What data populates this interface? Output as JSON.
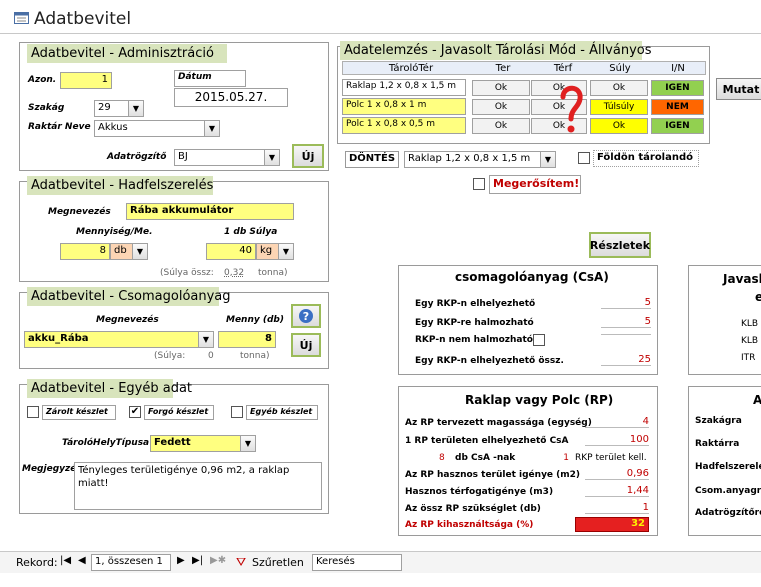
{
  "window": {
    "title": "Adatbevitel"
  },
  "admin": {
    "title": "Adatbevitel - Adminisztráció",
    "azon_label": "Azon.",
    "azon_value": "1",
    "datum_label": "Dátum",
    "datum_value": "2015.05.27.",
    "szakag_label": "Szakág",
    "szakag_value": "29",
    "raktar_label": "Raktár Neve",
    "raktar_value": "Akkus",
    "rogzito_label": "Adatrögzítő",
    "rogzito_value": "BJ",
    "uj_label": "Új"
  },
  "hadf": {
    "title": "Adatbevitel - Hadfelszerelés",
    "megnev_label": "Megnevezés",
    "megnev_value": "Rába akkumulátor",
    "menny_label": "Mennyiség/Me.",
    "menny_value": "8",
    "me_value": "db",
    "suly_label": "1 db Súlya",
    "suly_value": "40",
    "suly_unit": "kg",
    "ossz_label": "(Súlya össz:",
    "ossz_value": "0,32",
    "ossz_unit": "tonna)"
  },
  "csom": {
    "title": "Adatbevitel - Csomagolóanyag",
    "megnev_label": "Megnevezés",
    "megnev_value": "akku_Rába",
    "menny_label": "Menny (db)",
    "menny_value": "8",
    "suly_label": "(Súlya:",
    "suly_value": "0",
    "suly_unit": "tonna)",
    "uj_label": "Új"
  },
  "egyeb": {
    "title": "Adatbevitel - Egyéb adat",
    "zarolt": "Zárolt készlet",
    "forgo": "Forgó készlet",
    "egyeb_k": "Egyéb készlet",
    "tipus_label": "TárolóHelyTípusa",
    "tipus_value": "Fedett",
    "megj_label": "Megjegyzés",
    "megj_value": "Tényleges területigénye 0,96 m2, a raklap miatt!"
  },
  "elemzes": {
    "title": "Adatelemzés - Javasolt Tárolási Mód  - Állványos",
    "headers": [
      "TárolóTér",
      "Ter",
      "Térf",
      "Súly",
      "I/N"
    ],
    "rows": [
      {
        "name": "Raklap 1,2 x 0,8 x 1,5 m",
        "ter": "Ok",
        "terf": "Ok",
        "suly": "Ok",
        "in": "IGEN"
      },
      {
        "name": "Polc 1 x 0,8 x 1 m",
        "ter": "Ok",
        "terf": "Ok",
        "suly": "Túlsúly",
        "in": "NEM"
      },
      {
        "name": "Polc 1 x 0,8 x 0,5 m",
        "ter": "Ok",
        "terf": "Ok",
        "suly": "Ok",
        "in": "IGEN"
      }
    ],
    "mutat_label": "Mutat",
    "dontes_label": "DÖNTÉS",
    "dontes_value": "Raklap 1,2 x 0,8 x 1,5 m",
    "foldon_label": "Földön tárolandó",
    "megerosit_label": "Megerősítem!",
    "reszletek_label": "Részletek"
  },
  "csa": {
    "title": "csomagolóanyag (CsA)",
    "r1": "Egy RKP-n elhelyezhető",
    "v1": "5",
    "r2": "Egy RKP-re halmozható",
    "v2": "5",
    "r3": "RKP-n nem halmozható",
    "r4": "Egy RKP-n elhelyezhető össz.",
    "v4": "25"
  },
  "rp": {
    "title": "Raklap vagy Polc (RP)",
    "r1": "Az RP tervezett magassága (egység)",
    "v1": "4",
    "r2": "1 RP területen elhelyezhető CsA",
    "v2": "100",
    "r3a": "8",
    "r3b": "db CsA -nak",
    "r3c": "1",
    "r3d": "RKP terület kell.",
    "r4": "Az RP hasznos terület igénye (m2)",
    "v4": "0,96",
    "r5": "Hasznos térfogatigénye (m3)",
    "v5": "1,44",
    "r6": "Az össz RP szükséglet (db)",
    "v6": "1",
    "r7": "Az RP kihasználtsága (%)",
    "v7": "32"
  },
  "right1": {
    "title1": "Javasl",
    "title2": "e",
    "a": "KLB",
    "b": "KLB",
    "c": "ITR"
  },
  "right2": {
    "title": "A",
    "a": "Szakágra",
    "b": "Raktárra",
    "c": "Hadfelszerelés",
    "d": "Csom.anyagra",
    "e": "Adatrögzítőre"
  },
  "nav": {
    "rekord": "Rekord:",
    "pos": "1, összesen 1",
    "filter": "Szűretlen",
    "search": "Keresés"
  }
}
